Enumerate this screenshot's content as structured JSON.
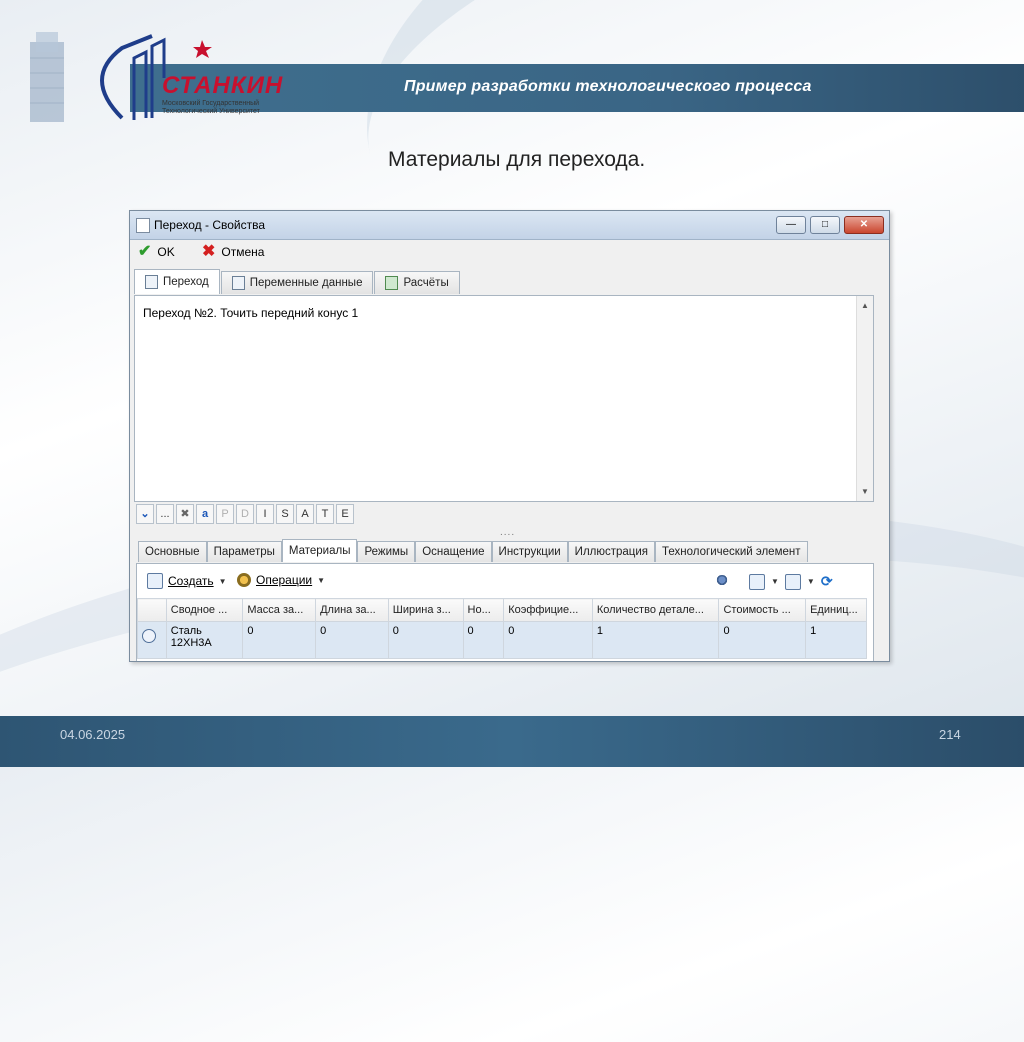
{
  "slide": {
    "header_title": "Пример разработки технологического процесса",
    "subtitle": "Материалы для перехода.",
    "date": "04.06.2025",
    "page_number": "214",
    "logo": {
      "name": "СТАНКИН",
      "subtitle_lines": [
        "Московский Государственный",
        "Технологический Университет"
      ]
    },
    "colors": {
      "header_bar": "#3a6585",
      "logo_red": "#c8102e"
    }
  },
  "window": {
    "title": "Переход - Свойства",
    "controls": {
      "min": "—",
      "max": "□",
      "close": "✕"
    },
    "toolbar": {
      "ok_label": "OK",
      "cancel_label": "Отмена"
    },
    "tabs": [
      {
        "label": "Переход",
        "active": true
      },
      {
        "label": "Переменные данные",
        "active": false
      },
      {
        "label": "Расчёты",
        "active": false
      }
    ],
    "editor_text": "Переход №2. Точить передний конус 1",
    "format_buttons": [
      "...",
      "P",
      "D",
      "I",
      "S",
      "A",
      "T",
      "E"
    ],
    "splitter": "....",
    "bottom_tabs": [
      {
        "label": "Основные",
        "active": false
      },
      {
        "label": "Параметры",
        "active": false
      },
      {
        "label": "Материалы",
        "active": true
      },
      {
        "label": "Режимы",
        "active": false
      },
      {
        "label": "Оснащение",
        "active": false
      },
      {
        "label": "Инструкции",
        "active": false
      },
      {
        "label": "Иллюстрация",
        "active": false
      },
      {
        "label": "Технологический элемент",
        "active": false
      }
    ],
    "panel_toolbar": {
      "create_label": "Создать",
      "operations_label": "Операции"
    },
    "table": {
      "columns": [
        "Сводное ...",
        "Масса за...",
        "Длина за...",
        "Ширина з...",
        "Но...",
        "Коэффицие...",
        "Количество детале...",
        "Стоимость ...",
        "Единиц..."
      ],
      "rows": [
        {
          "cells": [
            "Сталь 12ХН3А",
            "0",
            "0",
            "0",
            "0",
            "0",
            "1",
            "0",
            "1"
          ]
        }
      ]
    }
  }
}
